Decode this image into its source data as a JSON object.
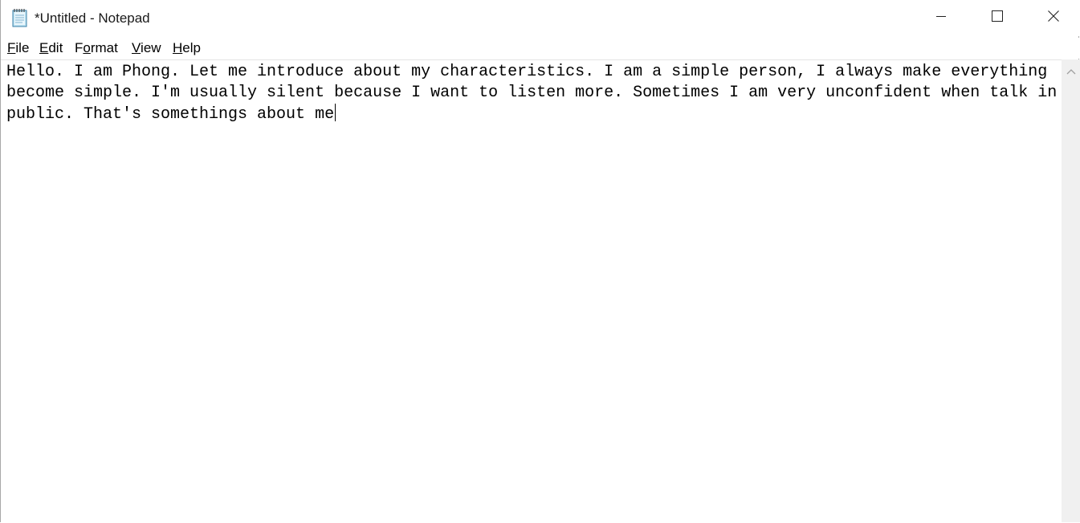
{
  "window": {
    "title": "*Untitled - Notepad",
    "icon": "notepad-icon",
    "controls": {
      "minimize": "minimize-icon",
      "maximize": "maximize-icon",
      "close": "close-icon"
    }
  },
  "menu": {
    "file": {
      "mnemonic": "F",
      "rest": "ile"
    },
    "edit": {
      "mnemonic": "E",
      "rest": "dit"
    },
    "format": {
      "pre": "F",
      "mnemonic": "o",
      "rest": "rmat"
    },
    "view": {
      "mnemonic": "V",
      "rest": "iew"
    },
    "help": {
      "mnemonic": "H",
      "rest": "elp"
    }
  },
  "editor": {
    "text": "Hello. I am Phong. Let me introduce about my characteristics. I am a simple person, I always make everything become simple. I'm usually silent because I want to listen more. Sometimes I am very unconfident when talk in public. That's somethings about me"
  },
  "scrollbar": {
    "up_arrow": "chevron-up-icon"
  },
  "colors": {
    "background": "#ffffff",
    "scrollbar_track": "#f0f0f0",
    "border": "#a8a8a8"
  }
}
